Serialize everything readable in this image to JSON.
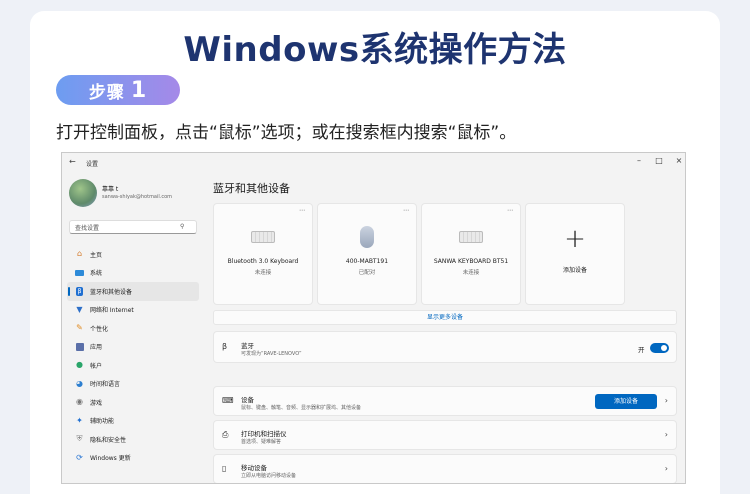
{
  "header": {
    "title": "Windows系统操作方法",
    "step_label": "步骤",
    "step_number": "1",
    "instruction": "打开控制面板，点击“鼠标”选项；或在搜索框内搜索“鼠标”。"
  },
  "window": {
    "title": "设置",
    "user": {
      "name": "靠靠 t",
      "email": "sanwa-shiyak@hotmail.com"
    },
    "search_placeholder": "查找设置",
    "nav": [
      {
        "label": "主页",
        "icon": "home-icon"
      },
      {
        "label": "系统",
        "icon": "monitor-icon"
      },
      {
        "label": "蓝牙和其他设备",
        "icon": "bluetooth-icon",
        "active": true
      },
      {
        "label": "网络和 Internet",
        "icon": "wifi-icon"
      },
      {
        "label": "个性化",
        "icon": "brush-icon"
      },
      {
        "label": "应用",
        "icon": "apps-icon"
      },
      {
        "label": "帐户",
        "icon": "account-icon"
      },
      {
        "label": "时间和语言",
        "icon": "globe-icon"
      },
      {
        "label": "游戏",
        "icon": "gamepad-icon"
      },
      {
        "label": "辅助功能",
        "icon": "accessibility-icon"
      },
      {
        "label": "隐私和安全性",
        "icon": "shield-icon"
      },
      {
        "label": "Windows 更新",
        "icon": "update-icon"
      }
    ],
    "content_title": "蓝牙和其他设备",
    "devices": [
      {
        "name": "Bluetooth 3.0 Keyboard",
        "status": "未连接",
        "icon": "keyboard-icon"
      },
      {
        "name": "400-MABT191",
        "status": "已配对",
        "icon": "mouse-icon"
      },
      {
        "name": "SANWA KEYBOARD BT51",
        "status": "未连接",
        "icon": "keyboard-icon"
      }
    ],
    "add_device_label": "添加设备",
    "show_more": "显示更多设备",
    "bluetooth_row": {
      "title": "蓝牙",
      "subtitle": "可发现为“RAVE-LENOVO”",
      "toggle_label": "开"
    },
    "devices_row": {
      "title": "设备",
      "subtitle": "鼠标、键盘、触笔、音频、显示器和扩展坞、其他设备",
      "button": "添加设备"
    },
    "printers_row": {
      "title": "打印机和扫描仪",
      "subtitle": "首选项、疑难解答"
    },
    "mobile_row": {
      "title": "移动设备",
      "subtitle": "立即从电脑访问移动设备"
    }
  }
}
